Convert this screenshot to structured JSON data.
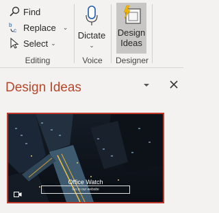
{
  "ribbon": {
    "editing": {
      "find_label": "Find",
      "replace_label": "Replace",
      "select_label": "Select",
      "group_label": "Editing"
    },
    "voice": {
      "dictate_label": "Dictate",
      "group_label": "Voice"
    },
    "designer": {
      "design_ideas_line1": "Design",
      "design_ideas_line2": "Ideas",
      "group_label": "Designer"
    }
  },
  "pane": {
    "title": "Design Ideas",
    "thumbnail": {
      "title": "Office Watch",
      "subtitle": "Go to our website"
    }
  },
  "colors": {
    "accent": "#b7472a",
    "selection_border": "#c0392b",
    "active_button_bg": "#c8c6c4"
  },
  "icons": [
    "find-icon",
    "replace-icon",
    "select-icon",
    "microphone-icon",
    "design-ideas-icon",
    "chevron-down-icon",
    "pane-options-icon",
    "close-icon",
    "video-icon"
  ]
}
